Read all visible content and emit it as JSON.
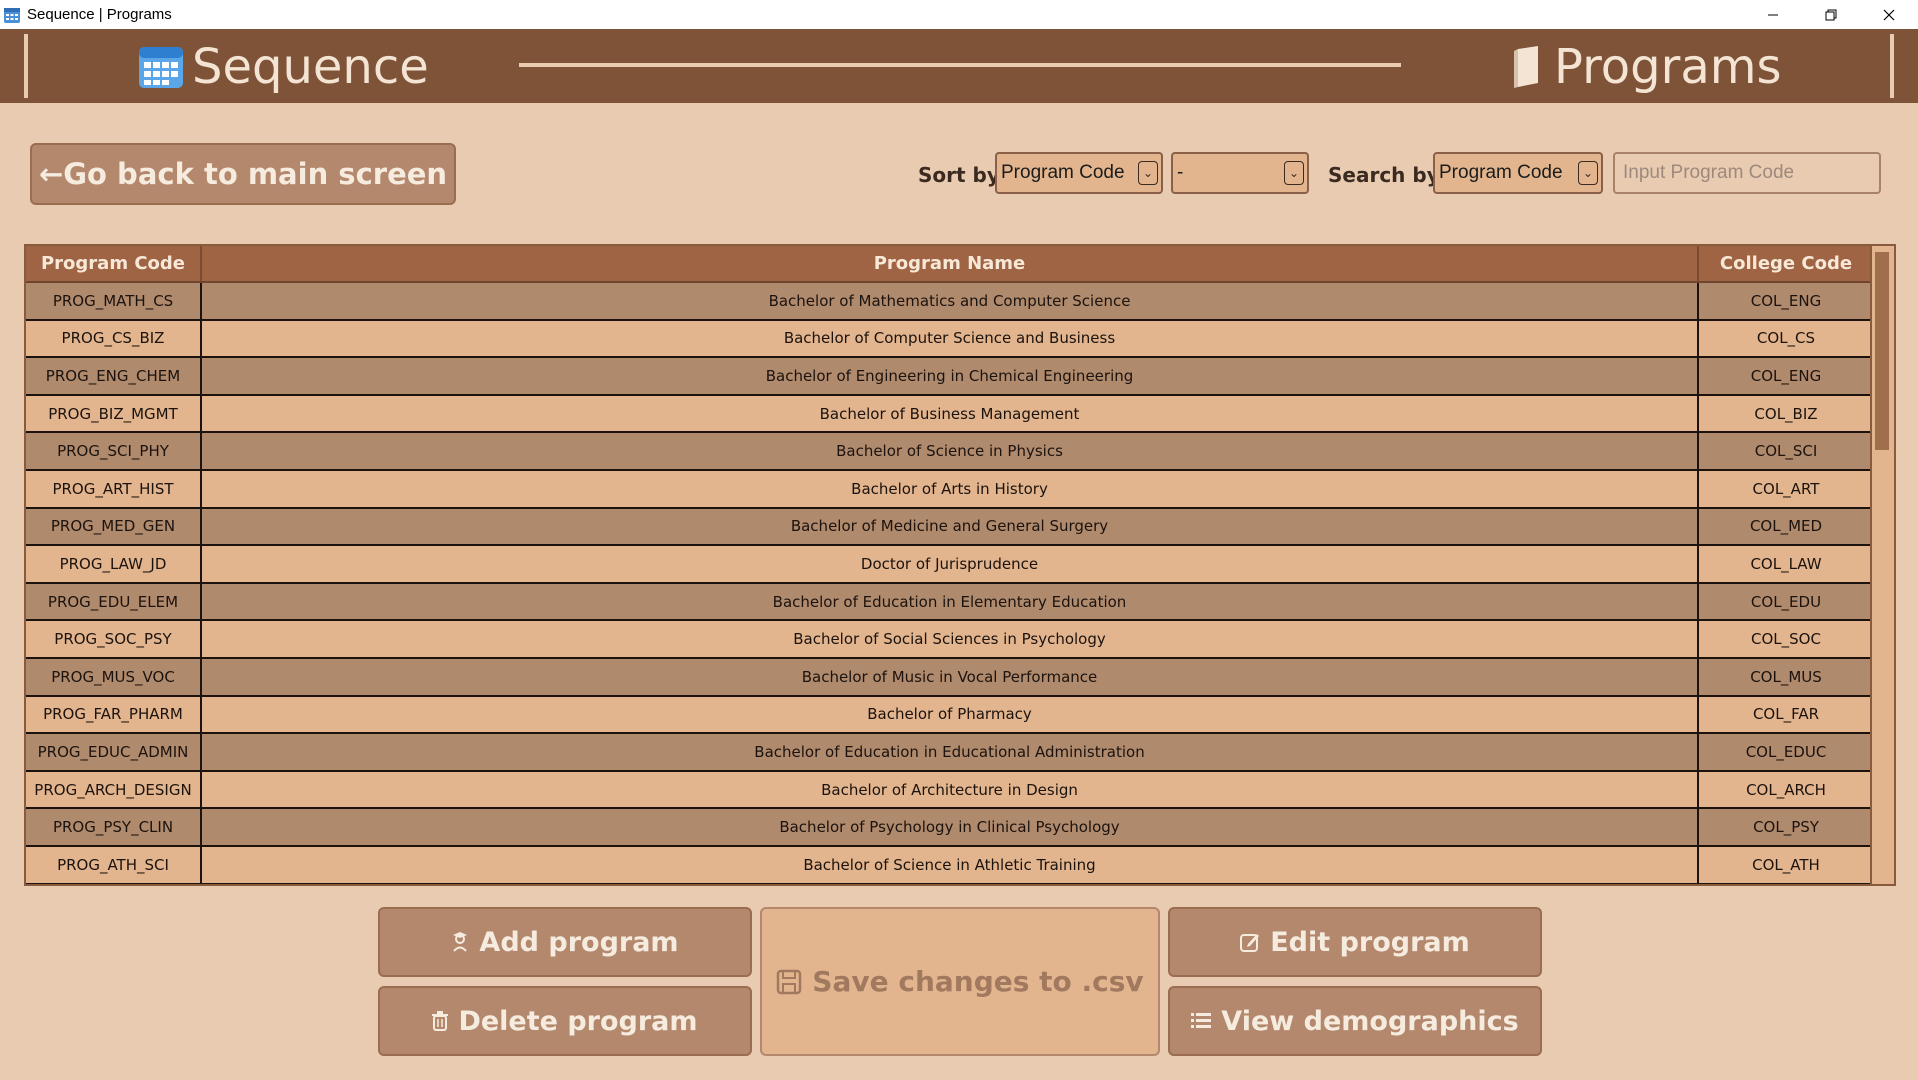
{
  "window": {
    "title": "Sequence | Programs",
    "controls": {
      "minimize": "—",
      "restore": "❐",
      "close": "✕"
    }
  },
  "header": {
    "brand": "Sequence",
    "brand_icon": "calendar-icon",
    "page_title": "Programs",
    "page_icon": "book-icon"
  },
  "toolbar": {
    "back_label": "←Go back to main screen",
    "sort_label": "Sort by",
    "sort_field": "Program Code",
    "sort_order": "-",
    "search_label": "Search by",
    "search_field": "Program Code",
    "search_placeholder": "Input Program Code"
  },
  "table": {
    "headers": [
      "Program Code",
      "Program Name",
      "College Code"
    ],
    "rows": [
      [
        "PROG_MATH_CS",
        "Bachelor of Mathematics and Computer Science",
        "COL_ENG"
      ],
      [
        "PROG_CS_BIZ",
        "Bachelor of Computer Science and Business",
        "COL_CS"
      ],
      [
        "PROG_ENG_CHEM",
        "Bachelor of Engineering in Chemical Engineering",
        "COL_ENG"
      ],
      [
        "PROG_BIZ_MGMT",
        "Bachelor of Business Management",
        "COL_BIZ"
      ],
      [
        "PROG_SCI_PHY",
        "Bachelor of Science in Physics",
        "COL_SCI"
      ],
      [
        "PROG_ART_HIST",
        "Bachelor of Arts in History",
        "COL_ART"
      ],
      [
        "PROG_MED_GEN",
        "Bachelor of Medicine and General Surgery",
        "COL_MED"
      ],
      [
        "PROG_LAW_JD",
        "Doctor of Jurisprudence",
        "COL_LAW"
      ],
      [
        "PROG_EDU_ELEM",
        "Bachelor of Education in Elementary Education",
        "COL_EDU"
      ],
      [
        "PROG_SOC_PSY",
        "Bachelor of Social Sciences in Psychology",
        "COL_SOC"
      ],
      [
        "PROG_MUS_VOC",
        "Bachelor of Music in Vocal Performance",
        "COL_MUS"
      ],
      [
        "PROG_FAR_PHARM",
        "Bachelor of Pharmacy",
        "COL_FAR"
      ],
      [
        "PROG_EDUC_ADMIN",
        "Bachelor of Education in Educational Administration",
        "COL_EDUC"
      ],
      [
        "PROG_ARCH_DESIGN",
        "Bachelor of Architecture in Design",
        "COL_ARCH"
      ],
      [
        "PROG_PSY_CLIN",
        "Bachelor of Psychology in Clinical Psychology",
        "COL_PSY"
      ],
      [
        "PROG_ATH_SCI",
        "Bachelor of Science in Athletic Training",
        "COL_ATH"
      ]
    ]
  },
  "actions": {
    "add": "Add program",
    "delete": "Delete program",
    "save": "Save changes to .csv",
    "edit": "Edit program",
    "demographics": "View demographics"
  },
  "colors": {
    "background": "#e8cbb1",
    "header": "#7f5337",
    "button": "#b4886d",
    "row_dark": "#b08a6d",
    "row_light": "#e2b58e"
  }
}
